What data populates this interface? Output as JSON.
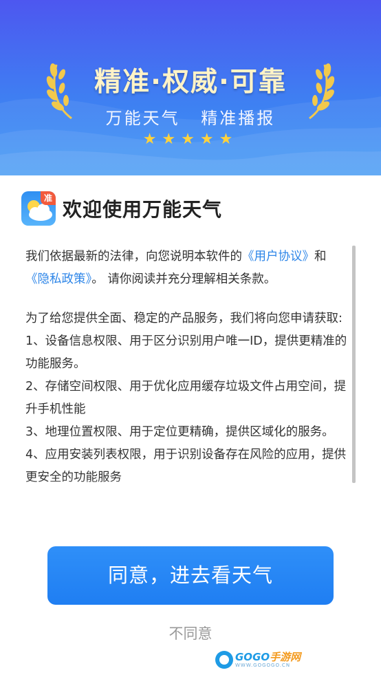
{
  "banner": {
    "slogan": "精准·权威·可靠",
    "subtitle": "万能天气  精准播报",
    "stars": "★★★★★",
    "colors": {
      "bg_top": "#4d57f0",
      "bg_bottom": "#3a95f5",
      "slogan": "#fff3c7",
      "stars": "#ffd23d",
      "laurel": "#f2c94c"
    }
  },
  "welcome": {
    "icon_badge": "准",
    "title": "欢迎使用万能天气"
  },
  "content": {
    "p1_a": "我们依据最新的法律，向您说明本软件的",
    "user_agreement_link": "《用户协议》",
    "p1_b": "和",
    "privacy_link": "《隐私政策》",
    "p1_c": "。 请你阅读并充分理解相关条款。",
    "p2": "为了给您提供全面、稳定的产品服务，我们将向您申请获取:",
    "items": [
      "1、设备信息权限、用于区分识别用户唯一ID，提供更精准的功能服务。",
      "2、存储空间权限、用于优化应用缓存垃圾文件占用空间，提升手机性能",
      "3、地理位置权限、用于定位更精确，提供区域化的服务。",
      "4、应用安装列表权限，用于识别设备存在风险的应用，提供更安全的功能服务"
    ],
    "link_color": "#2e86e8"
  },
  "actions": {
    "agree_label": "同意，进去看天气",
    "disagree_label": "不同意",
    "accent": "#1f7ef2"
  },
  "watermark": {
    "brand_a": "GOGO",
    "brand_b": "手游网",
    "url": "WWW.GOGOGO.CN"
  }
}
